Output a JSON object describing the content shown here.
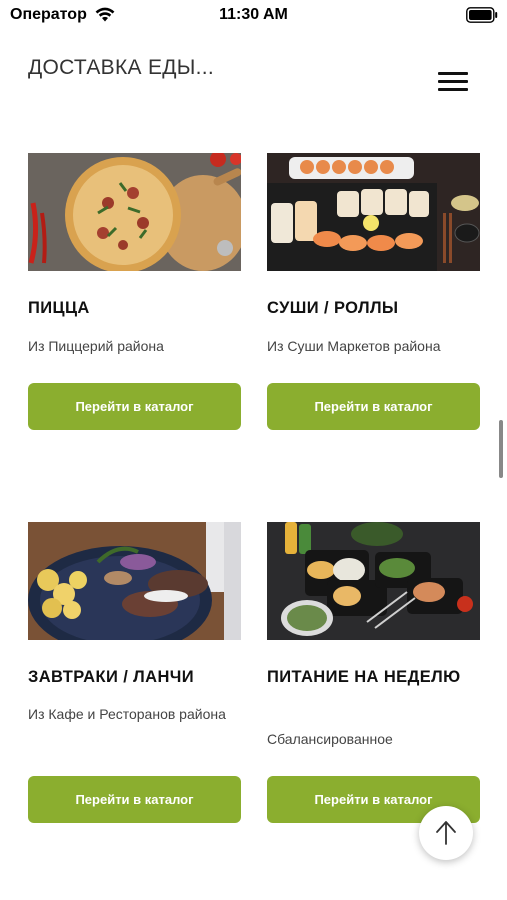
{
  "status_bar": {
    "carrier": "Оператор",
    "time": "11:30 AM"
  },
  "header": {
    "title": "ДОСТАВКА ЕДЫ..."
  },
  "categories": [
    {
      "title": "ПИЦЦА",
      "subtitle": "Из Пиццерий района",
      "button": "Перейти в каталог",
      "image": "pizza-photo"
    },
    {
      "title": "СУШИ / РОЛЛЫ",
      "subtitle": "Из Суши Маркетов района",
      "button": "Перейти в каталог",
      "image": "sushi-photo"
    },
    {
      "title": "ЗАВТРАКИ / ЛАНЧИ",
      "subtitle": "Из Кафе и Ресторанов района",
      "button": "Перейти в каталог",
      "image": "breakfast-photo"
    },
    {
      "title": "ПИТАНИЕ НА НЕДЕЛЮ",
      "subtitle": "Сбалансированное",
      "button": "Перейти в каталог",
      "image": "meal-prep-photo"
    }
  ],
  "colors": {
    "accent": "#8bae2f",
    "text": "#111111"
  },
  "icons": {
    "menu": "hamburger-menu-icon",
    "scroll_top": "arrow-up-icon"
  }
}
